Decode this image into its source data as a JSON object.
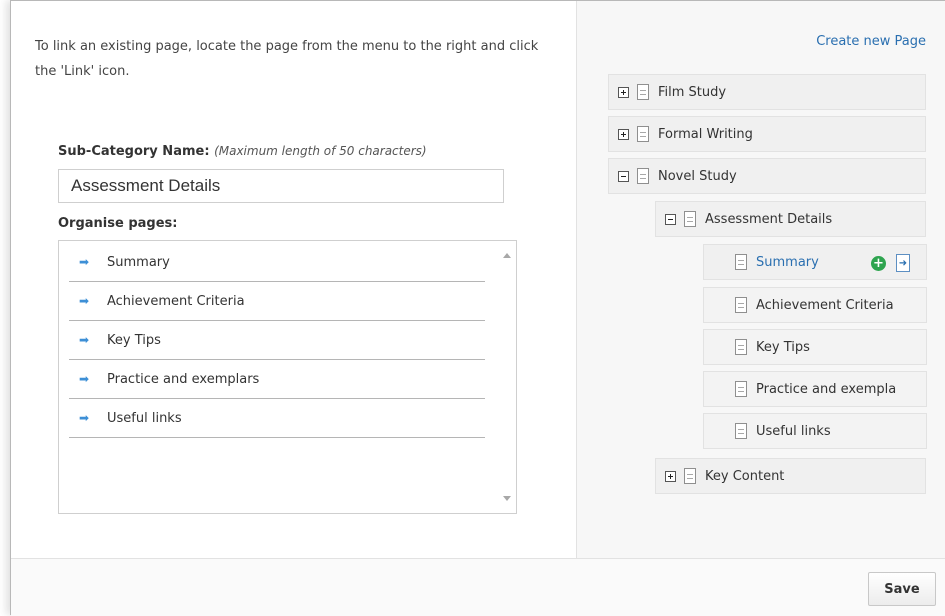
{
  "instructions": "To link an existing page, locate the page from the menu to the right and click the 'Link' icon.",
  "subcategory": {
    "label": "Sub-Category Name:",
    "hint": "(Maximum length of 50 characters)",
    "value": "Assessment Details"
  },
  "organise": {
    "label": "Organise pages:",
    "pages": [
      "Summary",
      "Achievement Criteria",
      "Key Tips",
      "Practice and exemplars",
      "Useful links"
    ]
  },
  "right_panel": {
    "create_link": "Create new Page",
    "tree": {
      "film_study": "Film Study",
      "formal_writing": "Formal Writing",
      "novel_study": "Novel Study",
      "assessment_details": "Assessment Details",
      "summary": "Summary",
      "achievement_criteria": "Achievement Criteria",
      "key_tips": "Key Tips",
      "practice": "Practice and exempla",
      "useful_links": "Useful links",
      "key_content": "Key Content"
    }
  },
  "footer": {
    "save_label": "Save"
  },
  "colors": {
    "link_blue": "#2a6fb0",
    "add_green": "#2ea44f",
    "arrow_blue": "#3d8fd6"
  }
}
